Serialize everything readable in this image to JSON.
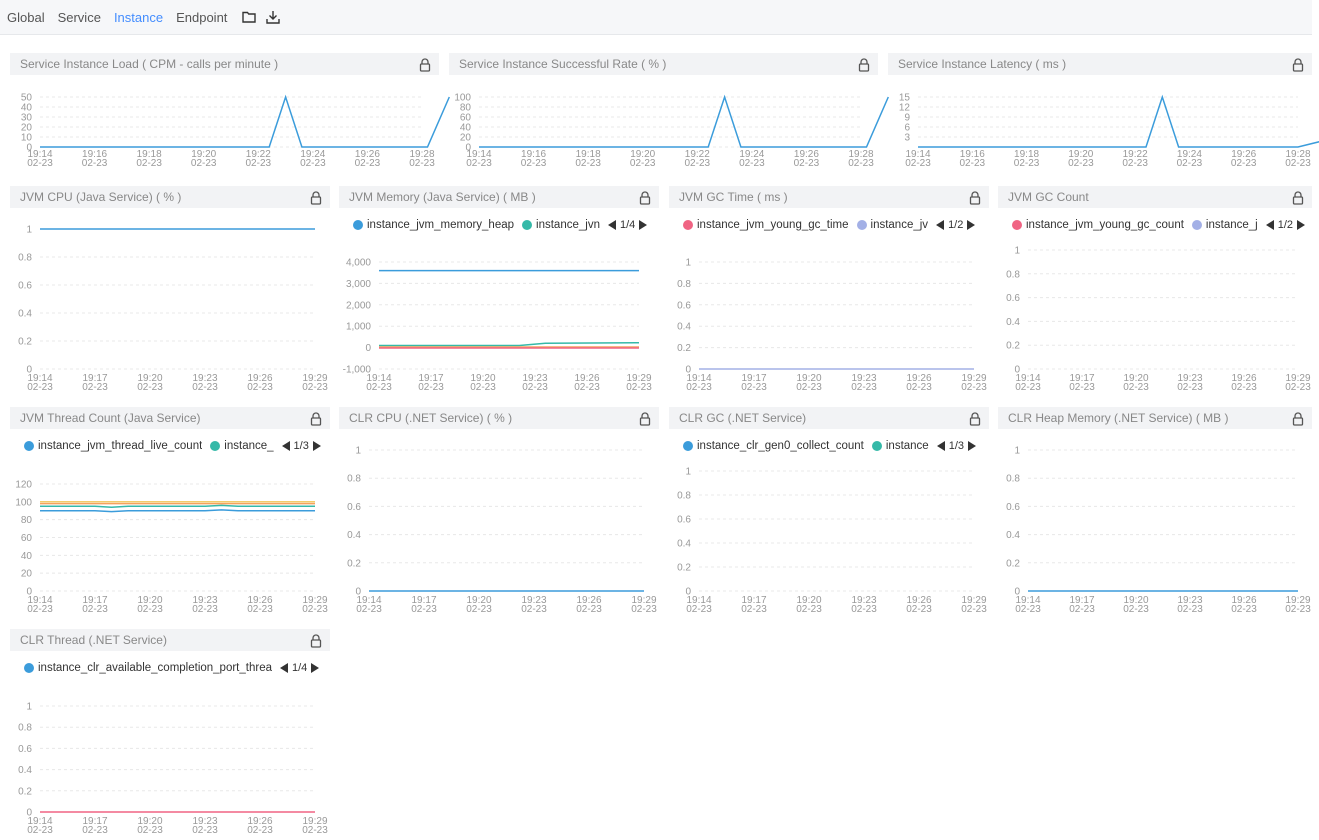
{
  "tabs": [
    {
      "label": "Global",
      "active": false
    },
    {
      "label": "Service",
      "active": false
    },
    {
      "label": "Instance",
      "active": true
    },
    {
      "label": "Endpoint",
      "active": false
    }
  ],
  "toolbar_icons": [
    "folder-icon",
    "download-icon"
  ],
  "colors": {
    "accent": "#448dfe",
    "series_blue": "#3b9cdb",
    "series_teal": "#35b9a8",
    "series_red": "#f06483",
    "series_lavender": "#a3b0e6",
    "series_orange": "#f5a25d",
    "series_yellow": "#f2cc6a"
  },
  "chart_data": [
    {
      "id": "load",
      "type": "line",
      "title": "Service Instance Load ( CPM - calls per minute )",
      "x": [
        "19:14\n02-23",
        "19:16\n02-23",
        "19:18\n02-23",
        "19:20\n02-23",
        "19:22\n02-23",
        "19:24\n02-23",
        "19:26\n02-23",
        "19:28\n02-23"
      ],
      "ylim": [
        0,
        50
      ],
      "yticks": [
        0,
        10,
        20,
        30,
        40,
        50
      ],
      "series": [
        {
          "color": "#3b9cdb",
          "points": [
            [
              0,
              0
            ],
            [
              1,
              0
            ],
            [
              2,
              0
            ],
            [
              3,
              0
            ],
            [
              4,
              0
            ],
            [
              4.2,
              0
            ],
            [
              4.5,
              50
            ],
            [
              4.8,
              0
            ],
            [
              5,
              0
            ],
            [
              6,
              0
            ],
            [
              7,
              0
            ],
            [
              7.1,
              0
            ],
            [
              7.5,
              50
            ]
          ]
        }
      ]
    },
    {
      "id": "success",
      "type": "line",
      "title": "Service Instance Successful Rate ( % )",
      "x": [
        "19:14\n02-23",
        "19:16\n02-23",
        "19:18\n02-23",
        "19:20\n02-23",
        "19:22\n02-23",
        "19:24\n02-23",
        "19:26\n02-23",
        "19:28\n02-23"
      ],
      "ylim": [
        0,
        100
      ],
      "yticks": [
        0,
        20,
        40,
        60,
        80,
        100
      ],
      "series": [
        {
          "color": "#3b9cdb",
          "points": [
            [
              0,
              0
            ],
            [
              1,
              0
            ],
            [
              2,
              0
            ],
            [
              3,
              0
            ],
            [
              4,
              0
            ],
            [
              4.2,
              0
            ],
            [
              4.5,
              100
            ],
            [
              4.8,
              0
            ],
            [
              5,
              0
            ],
            [
              6,
              0
            ],
            [
              7,
              0
            ],
            [
              7.1,
              0
            ],
            [
              7.5,
              100
            ]
          ]
        }
      ]
    },
    {
      "id": "latency",
      "type": "line",
      "title": "Service Instance Latency ( ms )",
      "x": [
        "19:14\n02-23",
        "19:16\n02-23",
        "19:18\n02-23",
        "19:20\n02-23",
        "19:22\n02-23",
        "19:24\n02-23",
        "19:26\n02-23",
        "19:28\n02-23"
      ],
      "ylim": [
        0,
        15
      ],
      "yticks": [
        3,
        6,
        9,
        12,
        15
      ],
      "series": [
        {
          "color": "#3b9cdb",
          "points": [
            [
              0,
              0
            ],
            [
              1,
              0
            ],
            [
              2,
              0
            ],
            [
              3,
              0
            ],
            [
              4,
              0
            ],
            [
              4.2,
              0
            ],
            [
              4.5,
              15
            ],
            [
              4.8,
              0
            ],
            [
              5,
              0
            ],
            [
              6,
              0
            ],
            [
              7,
              0
            ],
            [
              7.5,
              2
            ]
          ]
        }
      ]
    },
    {
      "id": "jvmcpu",
      "type": "line",
      "title": "JVM CPU (Java Service) ( % )",
      "x": [
        "19:14\n02-23",
        "19:17\n02-23",
        "19:20\n02-23",
        "19:23\n02-23",
        "19:26\n02-23",
        "19:29\n02-23"
      ],
      "ylim": [
        0,
        1
      ],
      "yticks": [
        0,
        0.2,
        0.4,
        0.6,
        0.8,
        1
      ],
      "series": [
        {
          "color": "#3b9cdb",
          "points": [
            [
              0,
              1
            ],
            [
              5,
              1
            ]
          ]
        }
      ]
    },
    {
      "id": "jvmmem",
      "type": "line",
      "title": "JVM Memory (Java Service) ( MB )",
      "legend": {
        "items": [
          {
            "label": "instance_jvm_memory_heap",
            "color": "#3b9cdb"
          },
          {
            "label": "instance_jvn",
            "color": "#35b9a8"
          }
        ],
        "page": "1/4"
      },
      "x": [
        "19:14\n02-23",
        "19:17\n02-23",
        "19:20\n02-23",
        "19:23\n02-23",
        "19:26\n02-23",
        "19:29\n02-23"
      ],
      "ylim": [
        -1000,
        4000
      ],
      "yticks": [
        -1000,
        0,
        1000,
        2000,
        3000,
        4000
      ],
      "series": [
        {
          "color": "#3b9cdb",
          "points": [
            [
              0,
              3600
            ],
            [
              5,
              3600
            ]
          ]
        },
        {
          "color": "#35b9a8",
          "points": [
            [
              0,
              100
            ],
            [
              2.7,
              100
            ],
            [
              3.2,
              200
            ],
            [
              5,
              230
            ]
          ]
        },
        {
          "color": "#f5a25d",
          "points": [
            [
              0,
              30
            ],
            [
              5,
              30
            ]
          ]
        },
        {
          "color": "#f06483",
          "points": [
            [
              0,
              -20
            ],
            [
              5,
              -20
            ]
          ]
        }
      ]
    },
    {
      "id": "gctime",
      "type": "line",
      "title": "JVM GC Time ( ms )",
      "legend": {
        "items": [
          {
            "label": "instance_jvm_young_gc_time",
            "color": "#f06483"
          },
          {
            "label": "instance_jv",
            "color": "#a3b0e6"
          }
        ],
        "page": "1/2"
      },
      "x": [
        "19:14\n02-23",
        "19:17\n02-23",
        "19:20\n02-23",
        "19:23\n02-23",
        "19:26\n02-23",
        "19:29\n02-23"
      ],
      "ylim": [
        0,
        1
      ],
      "yticks": [
        0,
        0.2,
        0.4,
        0.6,
        0.8,
        1
      ],
      "series": [
        {
          "color": "#a3b0e6",
          "points": [
            [
              0,
              0
            ],
            [
              5,
              0
            ]
          ]
        }
      ]
    },
    {
      "id": "gccount",
      "type": "line",
      "title": "JVM GC Count",
      "legend": {
        "items": [
          {
            "label": "instance_jvm_young_gc_count",
            "color": "#f06483"
          },
          {
            "label": "instance_j",
            "color": "#a3b0e6"
          }
        ],
        "page": "1/2"
      },
      "x": [
        "19:14\n02-23",
        "19:17\n02-23",
        "19:20\n02-23",
        "19:23\n02-23",
        "19:26\n02-23",
        "19:29\n02-23"
      ],
      "ylim": [
        0,
        1
      ],
      "yticks": [
        0,
        0.2,
        0.4,
        0.6,
        0.8,
        1
      ],
      "series": []
    },
    {
      "id": "thread",
      "type": "line",
      "title": "JVM Thread Count (Java Service)",
      "legend": {
        "items": [
          {
            "label": "instance_jvm_thread_live_count",
            "color": "#3b9cdb"
          },
          {
            "label": "instance_",
            "color": "#35b9a8"
          }
        ],
        "page": "1/3"
      },
      "x": [
        "19:14\n02-23",
        "19:17\n02-23",
        "19:20\n02-23",
        "19:23\n02-23",
        "19:26\n02-23",
        "19:29\n02-23"
      ],
      "ylim": [
        0,
        120
      ],
      "yticks": [
        0,
        20,
        40,
        60,
        80,
        100,
        120
      ],
      "series": [
        {
          "color": "#f2cc6a",
          "points": [
            [
              0,
              100
            ],
            [
              5,
              100
            ]
          ]
        },
        {
          "color": "#f5a25d",
          "points": [
            [
              0,
              98
            ],
            [
              5,
              98
            ]
          ]
        },
        {
          "color": "#35b9a8",
          "points": [
            [
              0,
              95
            ],
            [
              1,
              95
            ],
            [
              1.3,
              94
            ],
            [
              1.6,
              95
            ],
            [
              3,
              95
            ],
            [
              3.3,
              96
            ],
            [
              3.6,
              95
            ],
            [
              5,
              95
            ]
          ]
        },
        {
          "color": "#3b9cdb",
          "points": [
            [
              0,
              90
            ],
            [
              1,
              90
            ],
            [
              1.3,
              89
            ],
            [
              1.6,
              90
            ],
            [
              3,
              90
            ],
            [
              3.3,
              91
            ],
            [
              3.6,
              90
            ],
            [
              5,
              90
            ]
          ]
        }
      ]
    },
    {
      "id": "clrcpu",
      "type": "line",
      "title": "CLR CPU (.NET Service) ( % )",
      "x": [
        "19:14\n02-23",
        "19:17\n02-23",
        "19:20\n02-23",
        "19:23\n02-23",
        "19:26\n02-23",
        "19:29\n02-23"
      ],
      "ylim": [
        0,
        1
      ],
      "yticks": [
        0,
        0.2,
        0.4,
        0.6,
        0.8,
        1
      ],
      "series": [
        {
          "color": "#3b9cdb",
          "points": [
            [
              0,
              0
            ],
            [
              5,
              0
            ]
          ]
        }
      ]
    },
    {
      "id": "clrgc",
      "type": "line",
      "title": "CLR GC (.NET Service)",
      "legend": {
        "items": [
          {
            "label": "instance_clr_gen0_collect_count",
            "color": "#3b9cdb"
          },
          {
            "label": "instance",
            "color": "#35b9a8"
          }
        ],
        "page": "1/3"
      },
      "x": [
        "19:14\n02-23",
        "19:17\n02-23",
        "19:20\n02-23",
        "19:23\n02-23",
        "19:26\n02-23",
        "19:29\n02-23"
      ],
      "ylim": [
        0,
        1
      ],
      "yticks": [
        0,
        0.2,
        0.4,
        0.6,
        0.8,
        1
      ],
      "series": []
    },
    {
      "id": "clrheap",
      "type": "line",
      "title": "CLR Heap Memory (.NET Service) ( MB )",
      "x": [
        "19:14\n02-23",
        "19:17\n02-23",
        "19:20\n02-23",
        "19:23\n02-23",
        "19:26\n02-23",
        "19:29\n02-23"
      ],
      "ylim": [
        0,
        1
      ],
      "yticks": [
        0,
        0.2,
        0.4,
        0.6,
        0.8,
        1
      ],
      "series": [
        {
          "color": "#3b9cdb",
          "points": [
            [
              0,
              0
            ],
            [
              5,
              0
            ]
          ]
        }
      ]
    },
    {
      "id": "clrthread",
      "type": "line",
      "title": "CLR Thread (.NET Service)",
      "legend": {
        "items": [
          {
            "label": "instance_clr_available_completion_port_threa",
            "color": "#3b9cdb"
          }
        ],
        "page": "1/4"
      },
      "x": [
        "19:14\n02-23",
        "19:17\n02-23",
        "19:20\n02-23",
        "19:23\n02-23",
        "19:26\n02-23",
        "19:29\n02-23"
      ],
      "ylim": [
        0,
        1
      ],
      "yticks": [
        0,
        0.2,
        0.4,
        0.6,
        0.8,
        1
      ],
      "series": [
        {
          "color": "#f06483",
          "points": [
            [
              0,
              0
            ],
            [
              5,
              0
            ]
          ]
        }
      ]
    }
  ]
}
